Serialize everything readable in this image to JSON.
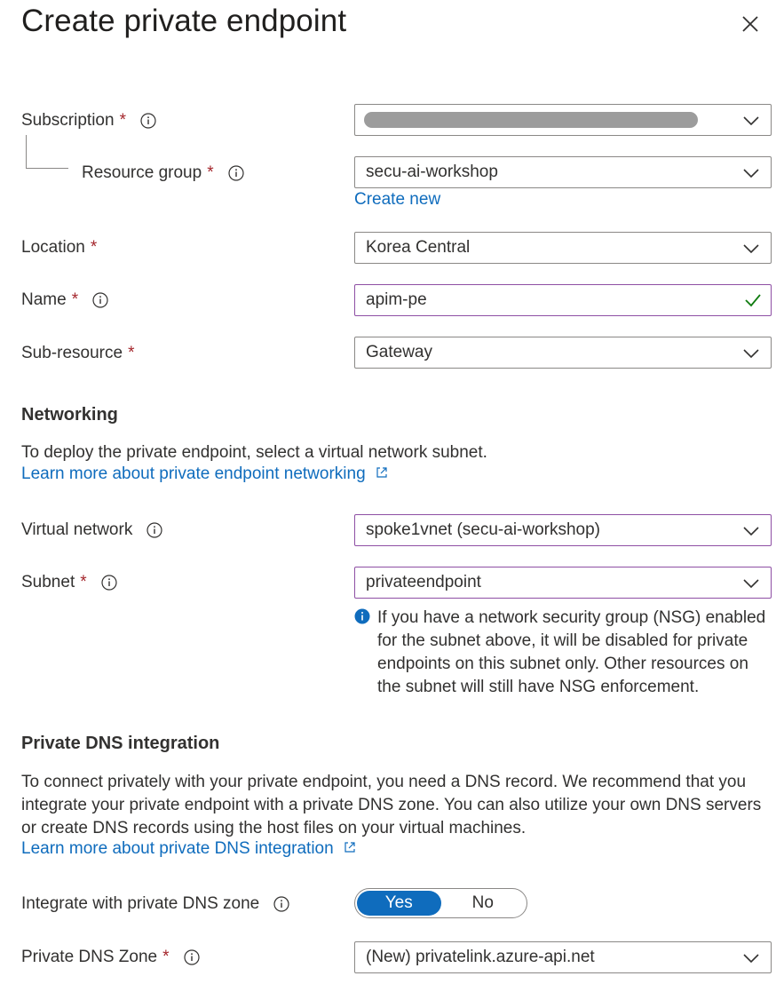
{
  "title": "Create private endpoint",
  "fields": {
    "subscription": {
      "label": "Subscription",
      "required": "*"
    },
    "resource_group": {
      "label": "Resource group",
      "required": "*",
      "value": "secu-ai-workshop",
      "create_new": "Create new"
    },
    "location": {
      "label": "Location",
      "required": "*",
      "value": "Korea Central"
    },
    "name": {
      "label": "Name",
      "required": "*",
      "value": "apim-pe"
    },
    "sub_resource": {
      "label": "Sub-resource",
      "required": "*",
      "value": "Gateway"
    }
  },
  "networking": {
    "heading": "Networking",
    "description": "To deploy the private endpoint, select a virtual network subnet.",
    "learn_more": "Learn more about private endpoint networking",
    "virtual_network": {
      "label": "Virtual network",
      "value": "spoke1vnet (secu-ai-workshop)"
    },
    "subnet": {
      "label": "Subnet",
      "required": "*",
      "value": "privateendpoint"
    },
    "nsg_note": "If you have a network security group (NSG) enabled for the subnet above, it will be disabled for private endpoints on this subnet only. Other resources on the subnet will still have NSG enforcement."
  },
  "dns": {
    "heading": "Private DNS integration",
    "description": "To connect privately with your private endpoint, you need a DNS record. We recommend that you integrate your private endpoint with a private DNS zone. You can also utilize your own DNS servers or create DNS records using the host files on your virtual machines.",
    "learn_more": "Learn more about private DNS integration",
    "integrate": {
      "label": "Integrate with private DNS zone",
      "yes": "Yes",
      "no": "No",
      "selected": "Yes"
    },
    "zone": {
      "label": "Private DNS Zone",
      "required": "*",
      "value": "(New) privatelink.azure-api.net"
    }
  },
  "colors": {
    "accent": "#0f6cbd",
    "required": "#a4262c",
    "valid": "#107c10",
    "focus_border": "#8e4fa4"
  },
  "icons": [
    "close-icon",
    "info-icon",
    "chevron-down-icon",
    "checkmark-icon",
    "external-link-icon",
    "info-filled-icon"
  ]
}
